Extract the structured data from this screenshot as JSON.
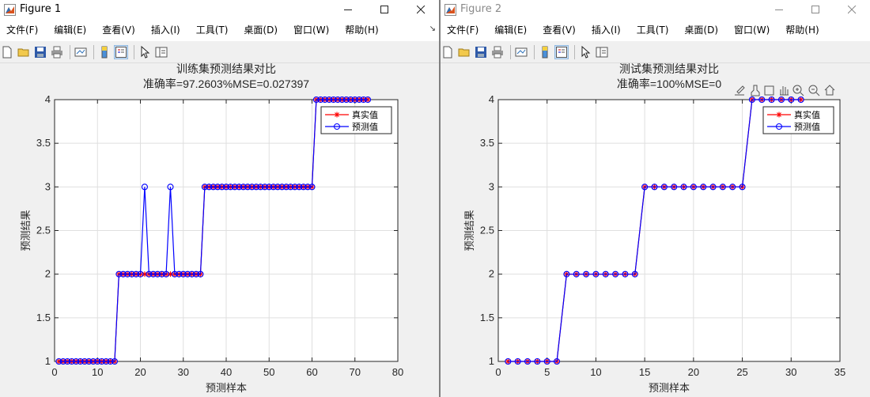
{
  "windows": [
    {
      "title": "Figure 1",
      "menu": [
        "文件(F)",
        "编辑(E)",
        "查看(V)",
        "插入(I)",
        "工具(T)",
        "桌面(D)",
        "窗口(W)",
        "帮助(H)"
      ],
      "chart_data": {
        "type": "line",
        "title": "训练集预测结果对比",
        "subtitle": "准确率=97.2603%MSE=0.027397",
        "xlabel": "预测样本",
        "ylabel": "预测结果",
        "xlim": [
          0,
          80
        ],
        "ylim": [
          1,
          4
        ],
        "xticks": [
          0,
          10,
          20,
          30,
          40,
          50,
          60,
          70,
          80
        ],
        "yticks": [
          1,
          1.5,
          2,
          2.5,
          3,
          3.5,
          4
        ],
        "grid": true,
        "legend_position": "top-right",
        "x": [
          1,
          2,
          3,
          4,
          5,
          6,
          7,
          8,
          9,
          10,
          11,
          12,
          13,
          14,
          15,
          16,
          17,
          18,
          19,
          20,
          21,
          22,
          23,
          24,
          25,
          26,
          27,
          28,
          29,
          30,
          31,
          32,
          33,
          34,
          35,
          36,
          37,
          38,
          39,
          40,
          41,
          42,
          43,
          44,
          45,
          46,
          47,
          48,
          49,
          50,
          51,
          52,
          53,
          54,
          55,
          56,
          57,
          58,
          59,
          60,
          61,
          62,
          63,
          64,
          65,
          66,
          67,
          68,
          69,
          70,
          71,
          72,
          73
        ],
        "series": [
          {
            "name": "真实值",
            "color": "#ff0000",
            "marker": "star",
            "values": [
              1,
              1,
              1,
              1,
              1,
              1,
              1,
              1,
              1,
              1,
              1,
              1,
              1,
              1,
              2,
              2,
              2,
              2,
              2,
              2,
              2,
              2,
              2,
              2,
              2,
              2,
              2,
              2,
              2,
              2,
              2,
              2,
              2,
              2,
              3,
              3,
              3,
              3,
              3,
              3,
              3,
              3,
              3,
              3,
              3,
              3,
              3,
              3,
              3,
              3,
              3,
              3,
              3,
              3,
              3,
              3,
              3,
              3,
              3,
              3,
              4,
              4,
              4,
              4,
              4,
              4,
              4,
              4,
              4,
              4,
              4,
              4,
              4
            ]
          },
          {
            "name": "预测值",
            "color": "#0000ff",
            "marker": "circle",
            "values": [
              1,
              1,
              1,
              1,
              1,
              1,
              1,
              1,
              1,
              1,
              1,
              1,
              1,
              1,
              2,
              2,
              2,
              2,
              2,
              2,
              3,
              2,
              2,
              2,
              2,
              2,
              3,
              2,
              2,
              2,
              2,
              2,
              2,
              2,
              3,
              3,
              3,
              3,
              3,
              3,
              3,
              3,
              3,
              3,
              3,
              3,
              3,
              3,
              3,
              3,
              3,
              3,
              3,
              3,
              3,
              3,
              3,
              3,
              3,
              3,
              4,
              4,
              4,
              4,
              4,
              4,
              4,
              4,
              4,
              4,
              4,
              4,
              4
            ]
          }
        ]
      }
    },
    {
      "title": "Figure 2",
      "menu": [
        "文件(F)",
        "编辑(E)",
        "查看(V)",
        "插入(I)",
        "工具(T)",
        "桌面(D)",
        "窗口(W)",
        "帮助(H)"
      ],
      "chart_data": {
        "type": "line",
        "title": "测试集预测结果对比",
        "subtitle": "准确率=100%MSE=0",
        "xlabel": "预测样本",
        "ylabel": "预测结果",
        "xlim": [
          0,
          35
        ],
        "ylim": [
          1,
          4
        ],
        "xticks": [
          0,
          5,
          10,
          15,
          20,
          25,
          30,
          35
        ],
        "yticks": [
          1,
          1.5,
          2,
          2.5,
          3,
          3.5,
          4
        ],
        "grid": true,
        "legend_position": "top-right",
        "x": [
          1,
          2,
          3,
          4,
          5,
          6,
          7,
          8,
          9,
          10,
          11,
          12,
          13,
          14,
          15,
          16,
          17,
          18,
          19,
          20,
          21,
          22,
          23,
          24,
          25,
          26,
          27,
          28,
          29,
          30,
          31
        ],
        "series": [
          {
            "name": "真实值",
            "color": "#ff0000",
            "marker": "star",
            "values": [
              1,
              1,
              1,
              1,
              1,
              1,
              2,
              2,
              2,
              2,
              2,
              2,
              2,
              2,
              3,
              3,
              3,
              3,
              3,
              3,
              3,
              3,
              3,
              3,
              3,
              4,
              4,
              4,
              4,
              4,
              4
            ]
          },
          {
            "name": "预测值",
            "color": "#0000ff",
            "marker": "circle",
            "values": [
              1,
              1,
              1,
              1,
              1,
              1,
              2,
              2,
              2,
              2,
              2,
              2,
              2,
              2,
              3,
              3,
              3,
              3,
              3,
              3,
              3,
              3,
              3,
              3,
              3,
              4,
              4,
              4,
              4,
              4,
              4
            ]
          }
        ]
      }
    }
  ]
}
